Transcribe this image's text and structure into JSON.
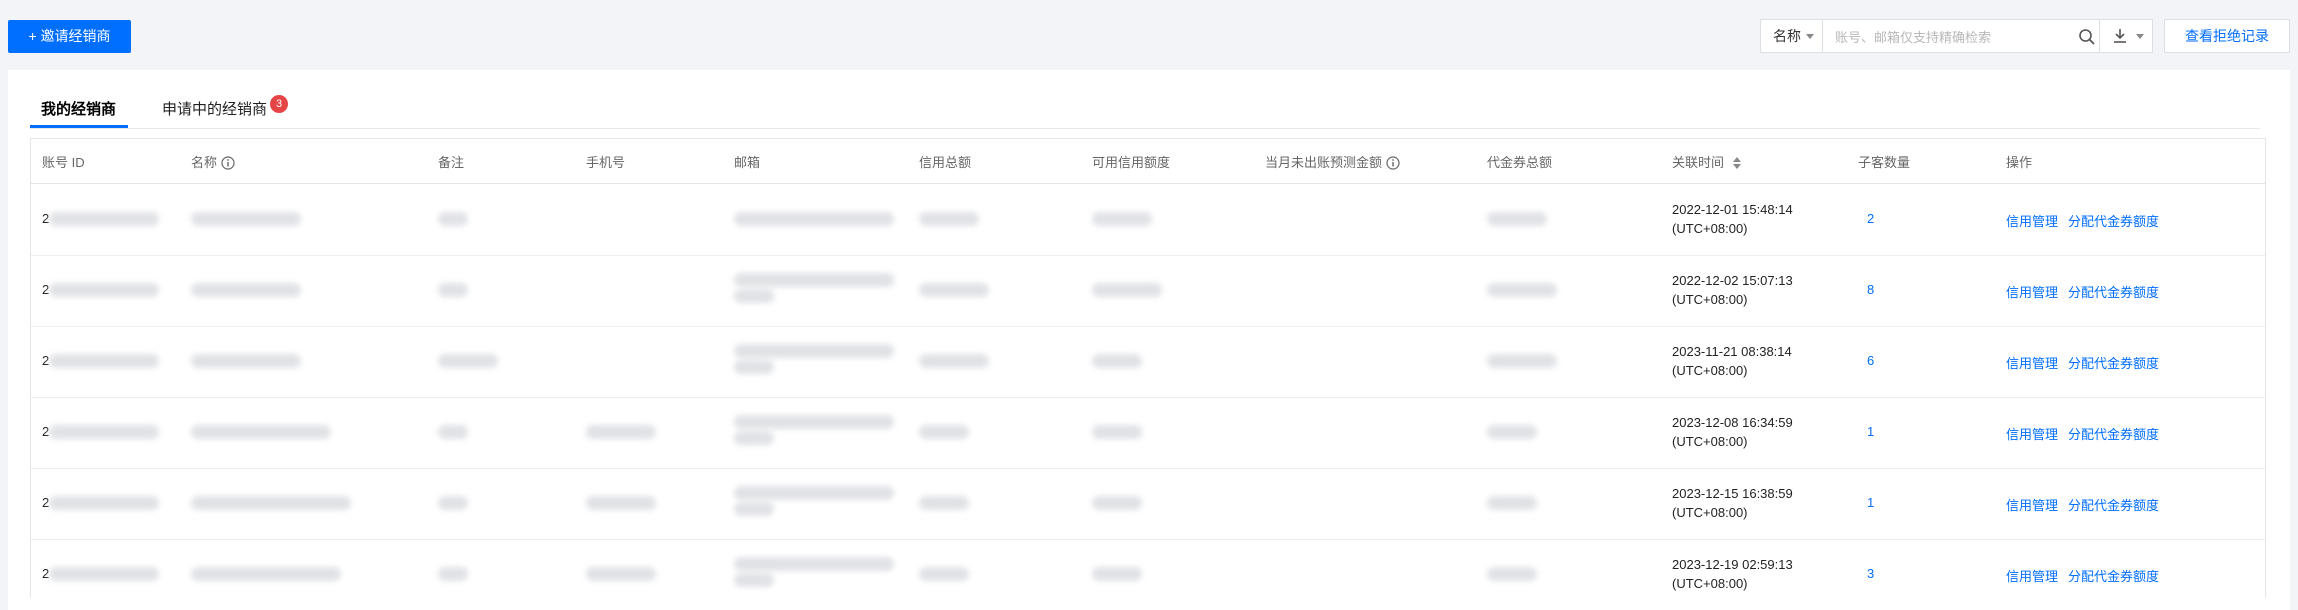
{
  "toolbar": {
    "invite_button": "+ 邀请经销商",
    "filter_select": "名称",
    "search_placeholder": "账号、邮箱仅支持精确检索",
    "reject_records_button": "查看拒绝记录"
  },
  "tabs": [
    {
      "label": "我的经销商",
      "active": true
    },
    {
      "label": "申请中的经销商",
      "badge": "3"
    }
  ],
  "columns": [
    "账号 ID",
    "名称",
    "备注",
    "手机号",
    "邮箱",
    "信用总额",
    "可用信用额度",
    "当月未出账预测金额",
    "代金券总额",
    "关联时间",
    "子客数量",
    "操作"
  ],
  "rows": [
    {
      "id_prefix": "2",
      "time": "2022-12-01 15:48:14",
      "tz": "(UTC+08:00)",
      "sub_count": "2",
      "op1": "信用管理",
      "op2": "分配代金券额度"
    },
    {
      "id_prefix": "2",
      "time": "2022-12-02 15:07:13",
      "tz": "(UTC+08:00)",
      "sub_count": "8",
      "op1": "信用管理",
      "op2": "分配代金券额度"
    },
    {
      "id_prefix": "2",
      "time": "2023-11-21 08:38:14",
      "tz": "(UTC+08:00)",
      "sub_count": "6",
      "op1": "信用管理",
      "op2": "分配代金券额度"
    },
    {
      "id_prefix": "2",
      "time": "2023-12-08 16:34:59",
      "tz": "(UTC+08:00)",
      "sub_count": "1",
      "op1": "信用管理",
      "op2": "分配代金券额度"
    },
    {
      "id_prefix": "2",
      "time": "2023-12-15 16:38:59",
      "tz": "(UTC+08:00)",
      "sub_count": "1",
      "op1": "信用管理",
      "op2": "分配代金券额度"
    },
    {
      "id_prefix": "2",
      "time": "2023-12-19 02:59:13",
      "tz": "(UTC+08:00)",
      "sub_count": "3",
      "op1": "信用管理",
      "op2": "分配代金券额度"
    }
  ],
  "colors": {
    "primary": "#006eff",
    "badge": "#e54545"
  }
}
